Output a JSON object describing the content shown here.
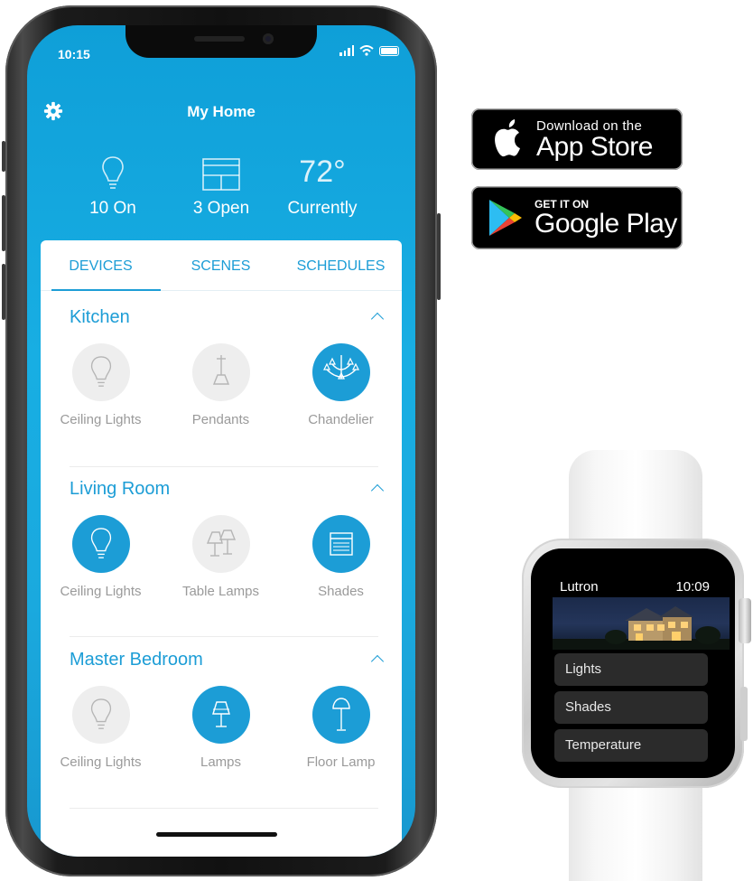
{
  "phone": {
    "status_time": "10:15",
    "app_title": "My Home",
    "summary": [
      {
        "label": "10 On",
        "icon": "lightbulb-icon"
      },
      {
        "label": "3 Open",
        "icon": "window-shade-icon"
      },
      {
        "label": "Currently",
        "value": "72°",
        "icon": "temperature-readout"
      }
    ],
    "tabs": [
      "DEVICES",
      "SCENES",
      "SCHEDULES"
    ],
    "active_tab": "DEVICES",
    "rooms": [
      {
        "name": "Kitchen",
        "devices": [
          {
            "label": "Ceiling Lights",
            "icon": "lightbulb-icon",
            "on": false
          },
          {
            "label": "Pendants",
            "icon": "pendant-lamp-icon",
            "on": false
          },
          {
            "label": "Chandelier",
            "icon": "chandelier-icon",
            "on": true
          }
        ]
      },
      {
        "name": "Living Room",
        "devices": [
          {
            "label": "Ceiling Lights",
            "icon": "lightbulb-icon",
            "on": true
          },
          {
            "label": "Table Lamps",
            "icon": "table-lamps-icon",
            "on": false
          },
          {
            "label": "Shades",
            "icon": "shade-icon",
            "on": true
          }
        ]
      },
      {
        "name": "Master Bedroom",
        "devices": [
          {
            "label": "Ceiling Lights",
            "icon": "lightbulb-icon",
            "on": false
          },
          {
            "label": "Lamps",
            "icon": "lamp-icon",
            "on": true
          },
          {
            "label": "Floor Lamp",
            "icon": "floor-lamp-icon",
            "on": true
          }
        ]
      }
    ]
  },
  "badges": {
    "apple": {
      "small": "Download on the",
      "big": "App Store"
    },
    "google": {
      "small": "GET IT ON",
      "big": "Google Play"
    }
  },
  "watch": {
    "app_name": "Lutron",
    "time": "10:09",
    "menu": [
      "Lights",
      "Shades",
      "Temperature"
    ]
  },
  "colors": {
    "accent": "#1c9dd6",
    "screen_top": "#0f9fd8",
    "device_off": "#eeeeee",
    "label_gray": "#9a9a9a"
  }
}
